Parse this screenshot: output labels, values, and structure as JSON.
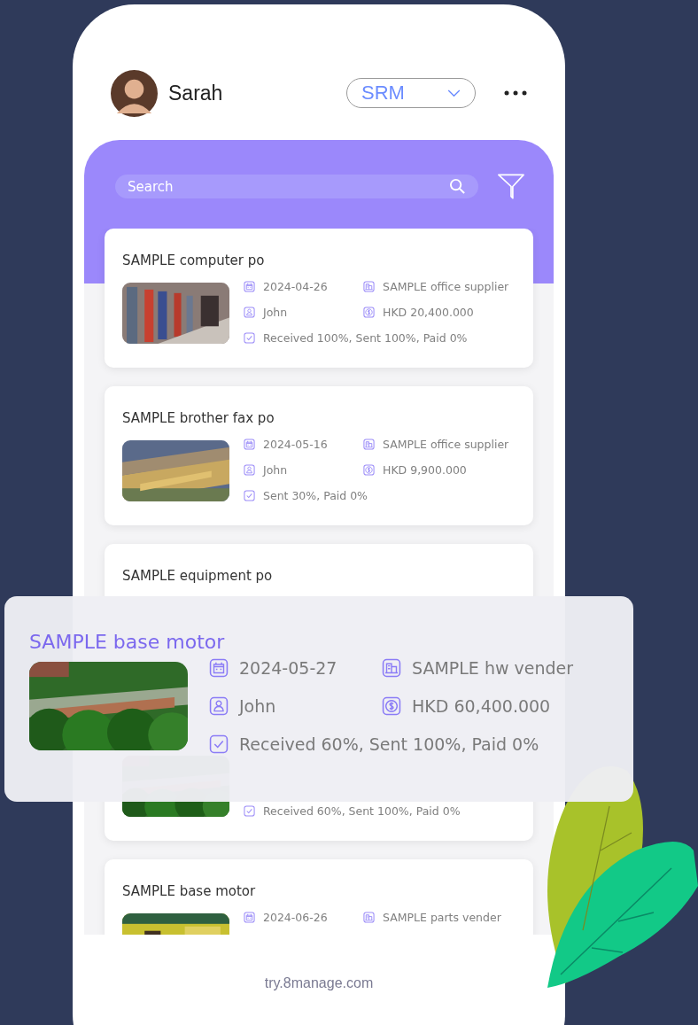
{
  "header": {
    "user_name": "Sarah",
    "module": "SRM"
  },
  "search": {
    "placeholder": "Search"
  },
  "orders": [
    {
      "title": "SAMPLE computer po",
      "date": "2024-04-26",
      "supplier": "SAMPLE office supplier",
      "owner": "John",
      "amount": "HKD 20,400.000",
      "status": "Received 100%,  Sent 100%, Paid 0%"
    },
    {
      "title": "SAMPLE brother fax po",
      "date": "2024-05-16",
      "supplier": "SAMPLE office supplier",
      "owner": "John",
      "amount": "HKD 9,900.000",
      "status": "Sent 30%, Paid 0%"
    },
    {
      "title": "SAMPLE equipment po"
    },
    {
      "status": "Received 60%,  Sent 100%, Paid 0%"
    },
    {
      "title": "SAMPLE base motor",
      "date": "2024-06-26",
      "supplier": "SAMPLE parts vender"
    }
  ],
  "highlight": {
    "title": "SAMPLE base motor",
    "date": "2024-05-27",
    "supplier": "SAMPLE hw vender",
    "owner": "John",
    "amount": "HKD 60,400.000",
    "status": "Received 60%,  Sent 100%, Paid 0%"
  },
  "footer": {
    "site": "try.8manage.com"
  }
}
